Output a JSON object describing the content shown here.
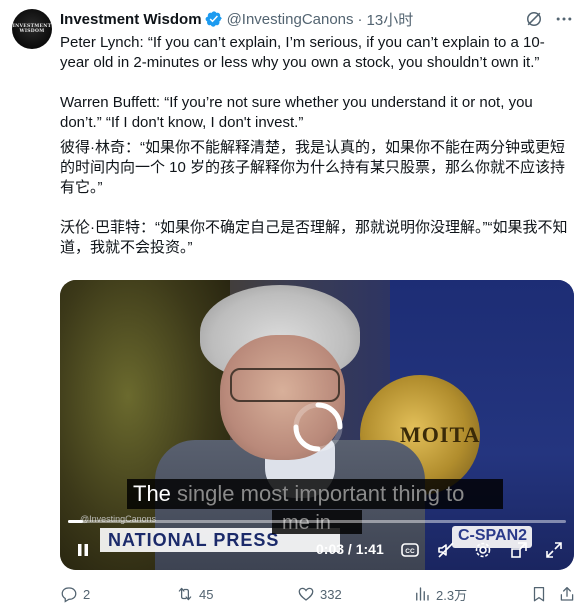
{
  "author": {
    "name": "Investment Wisdom",
    "handle": "@InvestingCanons",
    "time": "13小时",
    "avatar_line1": "INVESTMENT",
    "avatar_line2": "WISDOM"
  },
  "body": {
    "p1": "Peter Lynch: “If you can’t explain, I’m serious, if you can’t explain to a 10-year old in 2-minutes or less why you own a stock, you shouldn’t own it.”",
    "p2": "Warren Buffett: “If you’re not sure whether you understand it or not, you don’t.” “If I don't know, I don't invest.”",
    "p3": "彼得·林奇：“如果你不能解释清楚，我是认真的，如果你不能在两分钟或更短的时间内向一个 10 岁的孩子解释你为什么持有某只股票，那么你就不应该持有它。”",
    "p4": "沃伦·巴菲特：“如果你不确定自己是否理解，那就说明你没理解。”“如果我不知道，我就不会投资。”"
  },
  "video": {
    "caption_word_1": "The",
    "caption_rest_1": " single most important thing to",
    "caption_line_2": "me in",
    "banner_text": "NATIONAL PRESS",
    "seal_text": "MOITA",
    "network_text": "C-SPAN2",
    "watermark": "@InvestingCanons",
    "current_time": "0:03",
    "duration": "1:41",
    "time_separator": " / ",
    "progress_fraction": 0.03
  },
  "actions": {
    "replies": "2",
    "reposts": "45",
    "likes": "332",
    "views": "2.3万"
  },
  "colors": {
    "text": "#0f1419",
    "muted": "#536471",
    "verified": "#1d9bf0"
  }
}
